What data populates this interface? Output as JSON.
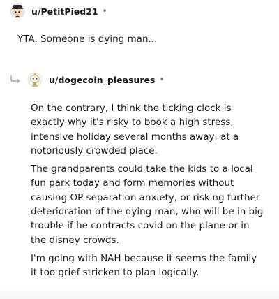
{
  "top_comment": {
    "username": "u/PetitPied21",
    "separator": "•",
    "text": "YTA. Someone is dying man..."
  },
  "reply": {
    "username": "u/dogecoin_pleasures",
    "separator": "•",
    "paragraphs": [
      "On the contrary, I think the ticking clock is exactly why it's risky to book a high stress, intensive holiday several months away, at a notoriously crowded place.",
      "The grandparents could take the kids to a local fun park today and form memories without causing OP separation anxiety, or risking further deterioration of the dying man, who will be in big trouble if he contracts covid on the plane or in the disney crowds.",
      "I'm going with NAH because it seems the family it too grief stricken to plan logically."
    ]
  },
  "icons": {
    "top_avatar": "snoo-avatar-icon",
    "reply_avatar": "snoo-avatar-icon",
    "reply_arrow": "reply-arrow-icon"
  },
  "colors": {
    "text": "#1c1c1c",
    "muted": "#7c7c7c",
    "arrow": "#a8a8a8"
  }
}
